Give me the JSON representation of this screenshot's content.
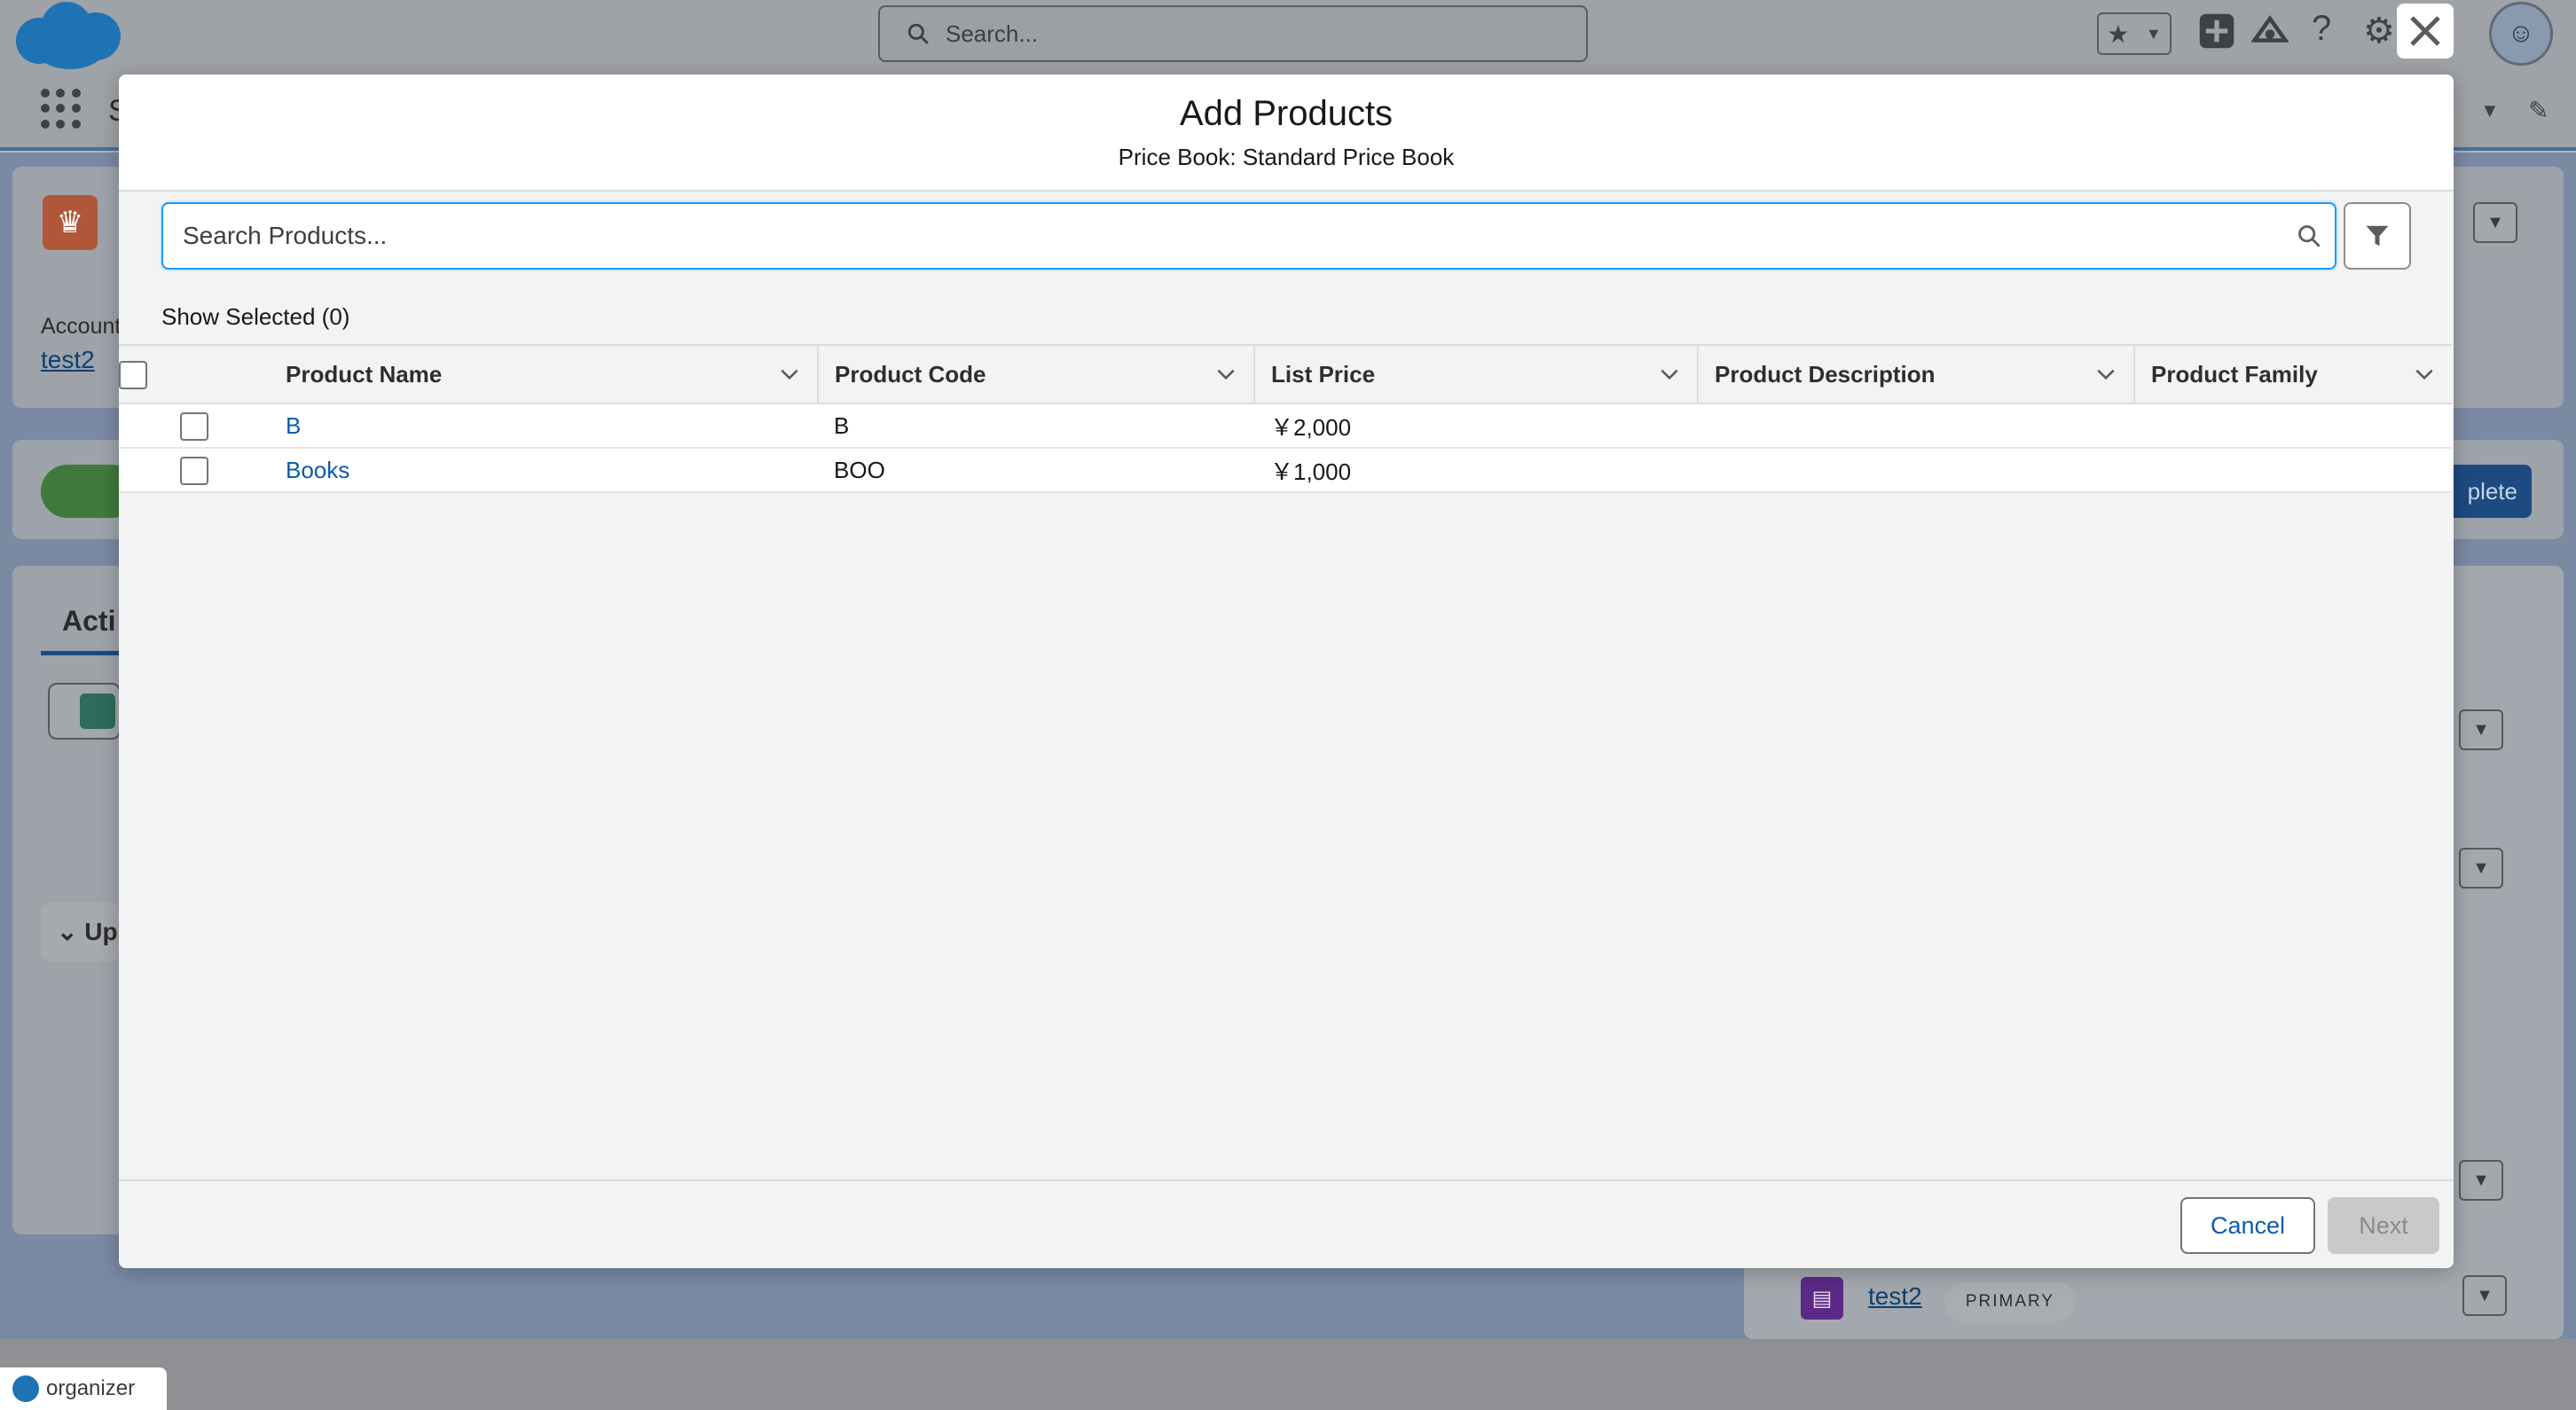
{
  "background": {
    "global_search_placeholder": "Search...",
    "account_label": "Account",
    "account_link": "test2",
    "tab_label": "Acti",
    "section_label": "Up",
    "right_button_label": "plete",
    "contact_name": "test2",
    "contact_badge": "PRIMARY",
    "org_label": "organizer",
    "app_initial": "S"
  },
  "modal": {
    "title": "Add Products",
    "subtitle": "Price Book: Standard Price Book",
    "search_placeholder": "Search Products...",
    "show_selected_label": "Show Selected (0)",
    "columns": [
      "Product Name",
      "Product Code",
      "List Price",
      "Product Description",
      "Product Family"
    ],
    "rows": [
      {
        "name": "B",
        "code": "B",
        "list_price": "￥2,000",
        "description": "",
        "family": ""
      },
      {
        "name": "Books",
        "code": "BOO",
        "list_price": "￥1,000",
        "description": "",
        "family": ""
      }
    ],
    "cancel_label": "Cancel",
    "next_label": "Next"
  },
  "colors": {
    "brand_blue": "#0b5cab",
    "focus_blue": "#1b96ff",
    "disabled_gray": "#c9c9c9"
  }
}
